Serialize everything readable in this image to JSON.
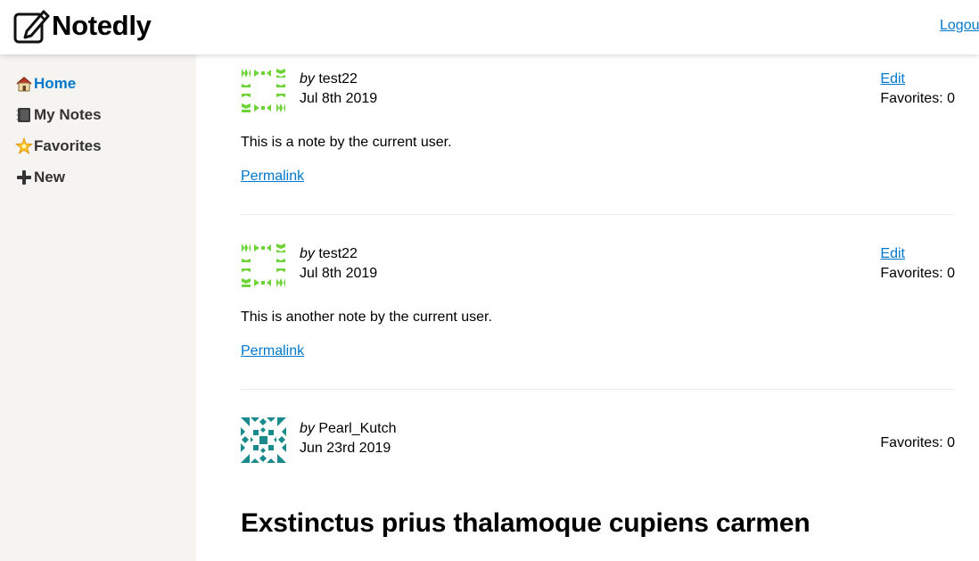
{
  "app": {
    "title": "Notedly",
    "logout_label": "Logout"
  },
  "nav": {
    "items": [
      {
        "label": "Home",
        "icon": "house-icon",
        "active": true
      },
      {
        "label": "My Notes",
        "icon": "notebook-icon",
        "active": false
      },
      {
        "label": "Favorites",
        "icon": "star-icon",
        "active": false
      },
      {
        "label": "New",
        "icon": "plus-icon",
        "active": false
      }
    ]
  },
  "notes": [
    {
      "by_label": "by",
      "author": "test22",
      "date": "Jul 8th 2019",
      "edit_label": "Edit",
      "favorites": "Favorites: 0",
      "content": "This is a note by the current user.",
      "permalink_label": "Permalink",
      "avatar_color": "#6ed336"
    },
    {
      "by_label": "by",
      "author": "test22",
      "date": "Jul 8th 2019",
      "edit_label": "Edit",
      "favorites": "Favorites: 0",
      "content": "This is another note by the current user.",
      "permalink_label": "Permalink",
      "avatar_color": "#6ed336"
    },
    {
      "by_label": "by",
      "author": "Pearl_Kutch",
      "date": "Jun 23rd 2019",
      "favorites": "Favorites: 0",
      "heading": "Exstinctus prius thalamoque cupiens carmen",
      "avatar_color": "#1a8a8c"
    }
  ],
  "colors": {
    "link": "#0077cc",
    "sidebar_bg": "#f5f4f0"
  }
}
